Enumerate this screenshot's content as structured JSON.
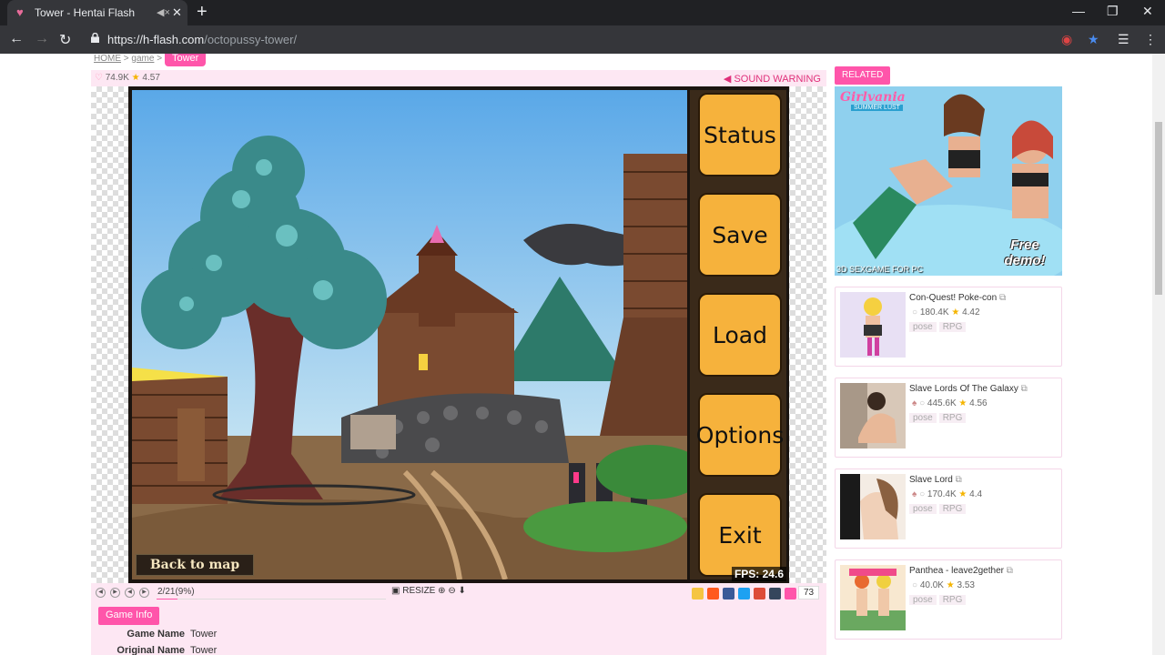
{
  "browser": {
    "tab_title": "Tower - Hentai Flash",
    "url_host": "https://h-flash.com",
    "url_path": "/octopussy-tower/"
  },
  "breadcrumb": {
    "home": "HOME",
    "sep1": ">",
    "game": "game",
    "sep2": ">",
    "current": "Tower"
  },
  "game_header": {
    "views": "74.9K",
    "rating": "4.57",
    "sound_warning": "SOUND WARNING"
  },
  "game_menu": {
    "status": "Status",
    "save": "Save",
    "load": "Load",
    "options": "Options",
    "exit": "Exit",
    "back_to_map": "Back to map",
    "fps": "FPS: 24.6"
  },
  "controls": {
    "progress": "2/21(9%)",
    "progress_fraction": 0.09,
    "resize": "RESIZE",
    "share_count": "73"
  },
  "game_info": {
    "button": "Game Info",
    "rows": [
      {
        "key": "Game Name",
        "value": "Tower"
      },
      {
        "key": "Original Name",
        "value": "Tower"
      }
    ]
  },
  "related": {
    "label": "RELATED",
    "ad": {
      "title": "Girlvania",
      "subtitle": "SUMMER LUST",
      "free": "Free demo!",
      "caption": "3D SEXGAME FOR PC"
    },
    "items": [
      {
        "title": "Con-Quest! Poke-con",
        "views": "180.4K",
        "rating": "4.42",
        "tags": [
          "pose",
          "RPG"
        ]
      },
      {
        "title": "Slave Lords Of The Galaxy",
        "views": "445.6K",
        "rating": "4.56",
        "tags": [
          "pose",
          "RPG"
        ]
      },
      {
        "title": "Slave Lord",
        "views": "170.4K",
        "rating": "4.4",
        "tags": [
          "pose",
          "RPG"
        ]
      },
      {
        "title": "Panthea - leave2gether",
        "views": "40.0K",
        "rating": "3.53",
        "tags": [
          "pose",
          "RPG"
        ]
      }
    ]
  },
  "colors": {
    "accent": "#ff55aa",
    "button": "#f6b23c"
  }
}
